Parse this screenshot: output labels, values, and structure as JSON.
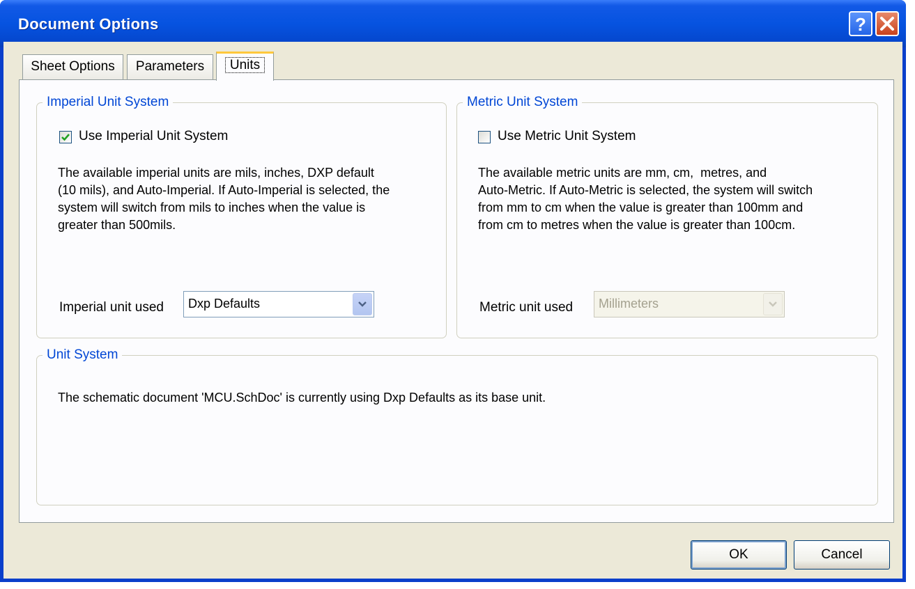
{
  "window": {
    "title": "Document Options",
    "help_glyph": "?",
    "close_glyph": "✕"
  },
  "tabs": [
    {
      "label": "Sheet Options"
    },
    {
      "label": "Parameters"
    },
    {
      "label": "Units",
      "active": true
    }
  ],
  "imperial": {
    "group_title": "Imperial Unit System",
    "checkbox_label": "Use Imperial Unit System",
    "checked": true,
    "description": "The available imperial units are mils, inches, DXP default\n(10 mils), and Auto-Imperial. If Auto-Imperial is selected, the\nsystem will switch from mils to inches when the value is\ngreater than 500mils.",
    "field_label": "Imperial unit used",
    "selected": "Dxp Defaults"
  },
  "metric": {
    "group_title": "Metric Unit System",
    "checkbox_label": "Use Metric Unit System",
    "checked": false,
    "description": "The available metric units are mm, cm,  metres, and\nAuto-Metric. If Auto-Metric is selected, the system will switch\nfrom mm to cm when the value is greater than 100mm and\nfrom cm to metres when the value is greater than 100cm.",
    "field_label": "Metric unit used",
    "selected": "Millimeters",
    "disabled": true
  },
  "unit_system": {
    "group_title": "Unit  System",
    "message": "The schematic document 'MCU.SchDoc' is currently using Dxp Defaults as its base unit."
  },
  "buttons": {
    "ok": "OK",
    "cancel": "Cancel"
  },
  "colors": {
    "title_bar": "#0653e0",
    "accent_legend": "#0046d5",
    "dialog_face": "#ece9d8",
    "check_mark": "#21a121"
  }
}
